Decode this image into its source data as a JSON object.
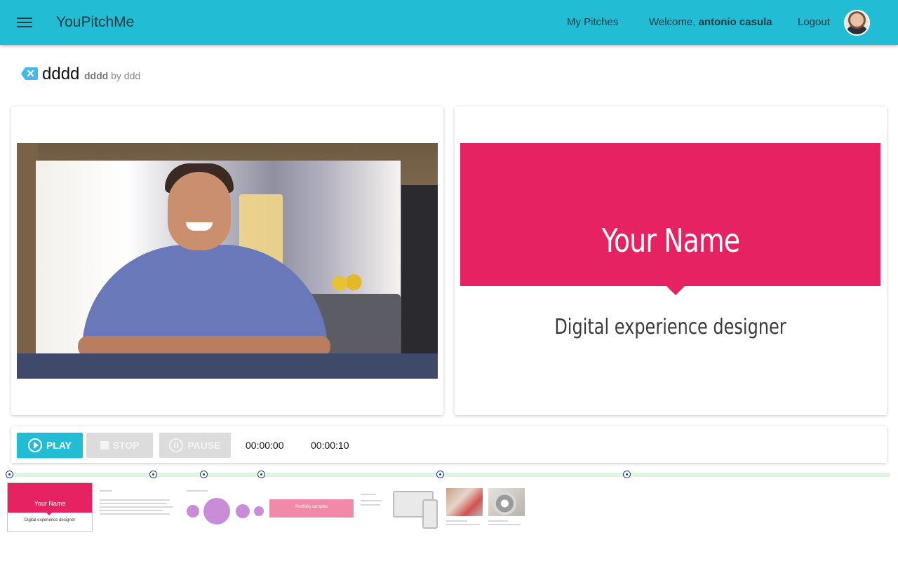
{
  "app": {
    "title": "YouPitchMe",
    "nav": {
      "my_pitches": "My Pitches",
      "welcome_prefix": "Welcome,",
      "user_name": "antonio casula",
      "logout": "Logout"
    },
    "accent_color": "#22bcd4"
  },
  "pitch": {
    "title": "dddd",
    "subtitle_name": "dddd",
    "subtitle_by": "by ddd"
  },
  "slide": {
    "name": "Your Name",
    "role": "Digital experience designer",
    "accent_color": "#e62263"
  },
  "controls": {
    "play_label": "PLAY",
    "stop_label": "STOP",
    "pause_label": "PAUSE",
    "time_current": "00:00:00",
    "time_total": "00:00:10"
  },
  "thumbnails": {
    "slide1_name": "Your Name",
    "slide1_role": "Digital experience designer",
    "slide4_label": "Portfolio samples"
  },
  "icons": {
    "menu": "menu-icon",
    "back": "close-tag-icon",
    "play": "play-circle-icon",
    "stop": "stop-icon",
    "pause": "pause-circle-icon",
    "marker": "timeline-marker-icon"
  }
}
